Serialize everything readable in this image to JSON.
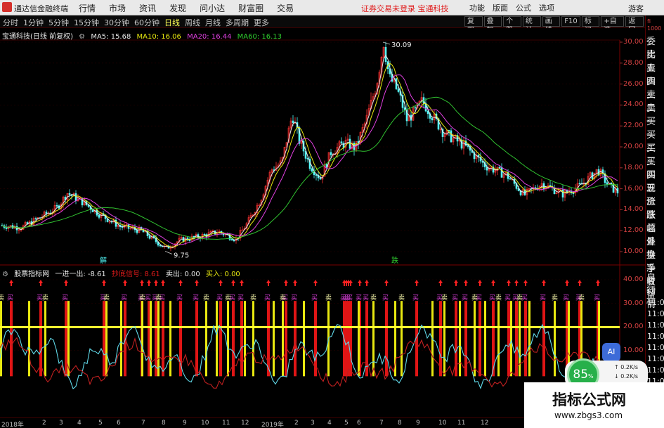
{
  "titlebar": {
    "app_name": "通达信金融终端",
    "menu": [
      "行情",
      "市场",
      "资讯",
      "发现",
      "问小达",
      "财富圈",
      "交易"
    ],
    "notice": "证券交易未登录  宝通科技",
    "right_menu": [
      "功能",
      "版面",
      "公式",
      "选项"
    ],
    "guest": "游客"
  },
  "toolbar": {
    "periods": [
      "分时",
      "1分钟",
      "5分钟",
      "15分钟",
      "30分钟",
      "60分钟",
      "日线",
      "周线",
      "月线",
      "多周期",
      "更多"
    ],
    "active_period": "日线",
    "tools": [
      "复权",
      "叠加",
      "个股",
      "统计",
      "画线",
      "F10",
      "标记",
      "+自选",
      "返回"
    ]
  },
  "main_chart": {
    "stock_title": "宝通科技(日线 前复权)",
    "ma": [
      {
        "label": "MA5: 15.68",
        "color": "#e8e8e8"
      },
      {
        "label": "MA10: 16.06",
        "color": "#e8e810"
      },
      {
        "label": "MA20: 16.44",
        "color": "#e040e0"
      },
      {
        "label": "MA60: 16.13",
        "color": "#30d030"
      }
    ],
    "high_label": "30.09",
    "low_label": "9.75",
    "event_labels": [
      "解",
      "跌"
    ]
  },
  "sub_chart": {
    "indicator": "股票指标网",
    "values": [
      {
        "label": "一进一出: -8.61",
        "color": "#e8e8e8"
      },
      {
        "label": "抄底信号: 8.61",
        "color": "#e01a1a"
      },
      {
        "label": "卖出: 0.00",
        "color": "#e8e8e8"
      },
      {
        "label": "买入: 0.00",
        "color": "#e8e810"
      }
    ],
    "buy_text": "买",
    "sell_text": "卖"
  },
  "y_axis_main": [
    "30.00",
    "28.00",
    "26.00",
    "24.00",
    "22.00",
    "20.00",
    "18.00",
    "16.00",
    "14.00",
    "12.00",
    "10.00"
  ],
  "y_axis_sub": [
    "40.00",
    "30.00",
    "20.00",
    "10.00"
  ],
  "x_axis": [
    "2018年",
    "2",
    "3",
    "4",
    "5",
    "6",
    "7",
    "8",
    "9",
    "10",
    "11",
    "12",
    "2019年",
    "2",
    "3",
    "4",
    "5",
    "6",
    "7",
    "8",
    "9",
    "10",
    "11",
    "12"
  ],
  "side_panel": {
    "top": [
      "fi",
      "1000"
    ],
    "items": [
      "委比",
      "卖五",
      "卖四",
      "卖三",
      "卖二",
      "卖一",
      "买一",
      "买二",
      "买三",
      "买四",
      "买五",
      "现价",
      "涨跌",
      "涨幅",
      "总量",
      "外盘",
      "换手",
      "净资",
      "收益"
    ],
    "bottom": [
      "自动",
      "行情",
      "11:0",
      "11:0",
      "11:0",
      "11:0",
      "11:0",
      "11:0",
      "11:0",
      "11:0",
      "11:0",
      "11:0",
      "11:0"
    ]
  },
  "overlay": {
    "ai_label": "AI",
    "gauge_value": "85",
    "gauge_unit": "%",
    "net_up": "0.2K/s",
    "net_down": "0.2K/s",
    "watermark_title": "指标公式网",
    "watermark_url": "www.zbgs3.com"
  }
}
